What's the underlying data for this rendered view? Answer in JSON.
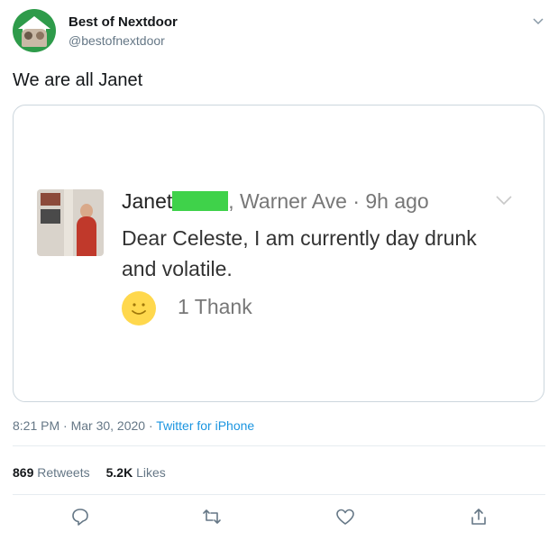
{
  "author": {
    "name": "Best of Nextdoor",
    "handle": "@bestofnextdoor",
    "avatar_icon": "best-of-nextdoor-logo"
  },
  "tweet": {
    "text": "We are all Janet"
  },
  "embedded_post": {
    "author_name": "Janet",
    "location_time": ", Warner Ave · 9h ago",
    "body": "Dear Celeste, I am currently day drunk and volatile.",
    "thanks_label": "1 Thank",
    "redaction_color": "#3fd24a"
  },
  "meta": {
    "time_date": "8:21 PM · Mar 30, 2020 · ",
    "source": "Twitter for iPhone"
  },
  "stats": {
    "retweets_count": "869",
    "retweets_label": "Retweets",
    "likes_count": "5.2K",
    "likes_label": "Likes"
  },
  "actions": {
    "reply_icon": "reply-icon",
    "retweet_icon": "retweet-icon",
    "like_icon": "heart-icon",
    "share_icon": "share-icon"
  },
  "colors": {
    "link": "#1b95e0",
    "secondary_text": "#657786",
    "border": "#ccd6dd"
  }
}
